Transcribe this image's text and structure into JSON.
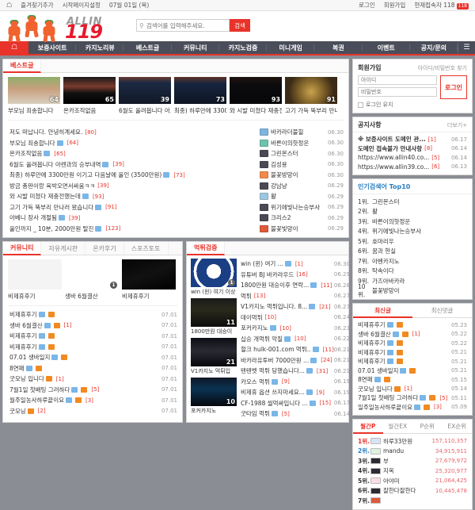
{
  "topbar": {
    "home_icon": "home-icon",
    "left_links": [
      "즐겨찾기추가",
      "시작페이지설정",
      "07월 01일 (목)"
    ],
    "right_links": [
      "로그인",
      "회원가입"
    ],
    "visitors_label": "현재접속자 118",
    "visitors_badge": "118"
  },
  "header": {
    "logo_top": "ALLIN",
    "logo_main": "119",
    "search_placeholder": "검색어를 입력해주세요.",
    "search_value": "",
    "search_button": "검색",
    "search_icon": "search-icon"
  },
  "nav": {
    "home_icon": "home-icon",
    "items": [
      "보증사이트",
      "카지노리뷰",
      "베스트글",
      "커뮤니티",
      "카지노검증",
      "미니게임",
      "복권",
      "이벤트",
      "공지/문의"
    ],
    "menu_icon": "hamburger-icon"
  },
  "best": {
    "tab": "베스트글",
    "thumbs": [
      {
        "title": "부모님 죄송합니다",
        "count": "64"
      },
      {
        "title": "온카조작없음",
        "count": "65"
      },
      {
        "title": "6월도 올려봅니다 아…",
        "count": "39"
      },
      {
        "title": "최종) 하루만에 3300…",
        "count": "73"
      },
      {
        "title": "와 시발 미쳤다 재충전",
        "count": "93"
      },
      {
        "title": "고기 가득 뚝부리 만나…",
        "count": "91"
      }
    ],
    "posts": [
      {
        "title": "저도 떠납니다. 안녕히계세요.",
        "count": "[80]",
        "img": false
      },
      {
        "title": "부모님 죄송합니다",
        "count": "[64]",
        "img": true
      },
      {
        "title": "온카조작없음",
        "count": "[65]",
        "img": true
      },
      {
        "title": "6월도 올려봅니다 아렌과의 승부내역",
        "count": "[39]",
        "img": true
      },
      {
        "title": "최종) 하루만에 3300만원 이기고 다음날에 올인 (3500만원)",
        "count": "[73]",
        "img": true
      },
      {
        "title": "방금 총판이랑 육박오면서싸움ㅋㅋ",
        "count": "[39]",
        "img": false
      },
      {
        "title": "와 시발 미쳤다 재충전했는데",
        "count": "[93]",
        "img": true
      },
      {
        "title": "고기 가득 뚝부리 만나러 왔습니다",
        "count": "[91]",
        "img": true
      },
      {
        "title": "아베니 장사 개절됨",
        "count": "[39]",
        "img": true
      },
      {
        "title": "올인까지 _ 10분, 2000만원 탈진",
        "count": "[123]",
        "img": true
      }
    ],
    "users": [
      {
        "name": "바카라더불힐",
        "time": "06.30",
        "color": "#7fb4dd"
      },
      {
        "name": "바른이의핫정운",
        "time": "06.30",
        "color": "#6fc3ad"
      },
      {
        "name": "그린몬스터",
        "time": "06.30",
        "color": "#4a4a55"
      },
      {
        "name": "김성용",
        "time": "06.30",
        "color": "#4a4a55"
      },
      {
        "name": "불꽃방망이",
        "time": "06.30",
        "color": "#f08a4a"
      },
      {
        "name": "강남냥",
        "time": "06.29",
        "color": "#4a4a55"
      },
      {
        "name": "활",
        "time": "06.29",
        "color": "#9ec6e0"
      },
      {
        "name": "위기에빛나는승부사",
        "time": "06.29",
        "color": "#4a4a55"
      },
      {
        "name": "크리스2",
        "time": "06.29",
        "color": "#4a4a55"
      },
      {
        "name": "불꽃빛망이",
        "time": "06.29",
        "color": "#e05a3a"
      }
    ]
  },
  "community": {
    "tabs": [
      "커뮤니티",
      "자유게시판",
      "온카후기",
      "스포츠토토"
    ],
    "thumbs": [
      {
        "title": "비제휴후기",
        "count": ""
      },
      {
        "title": "생바 6월결산",
        "count": "1"
      },
      {
        "title": "비제휴후기",
        "count": ""
      }
    ],
    "posts": [
      {
        "title": "비제휴후기",
        "count": "",
        "date": "07.01"
      },
      {
        "title": "생바 6월결산",
        "count": "[1]",
        "date": "07.01"
      },
      {
        "title": "비제휴후기",
        "count": "",
        "date": "07.01"
      },
      {
        "title": "비제휴후기",
        "count": "",
        "date": "07.01"
      },
      {
        "title": "07.01 생바일지",
        "count": "",
        "date": "07.01"
      },
      {
        "title": "8연패",
        "count": "",
        "date": "07.01"
      },
      {
        "title": "굿모닝 입니다",
        "count": "[1]",
        "date": "07.01"
      },
      {
        "title": "7월1일 첫배팅 그러하다",
        "count": "[5]",
        "date": "07.01"
      },
      {
        "title": "월주일농사하루끝이요",
        "count": "[3]",
        "date": "07.01"
      },
      {
        "title": "굿모닝",
        "count": "[2]",
        "date": "07.01"
      }
    ]
  },
  "verify": {
    "tab": "먹튀검증",
    "thumbs": [
      {
        "title": "win (윈) 여기 이상",
        "count": "1"
      },
      {
        "title": "1800만원 대승이",
        "count": "11"
      },
      {
        "title": "V1카지노 먹튀입",
        "count": "21"
      },
      {
        "title": "포커카지노",
        "count": "10"
      }
    ],
    "posts": [
      {
        "title": "win (윈) 여기 ...",
        "count": "[1]",
        "date": "06.30"
      },
      {
        "title": "유튜버 BJ 바카라우드",
        "count": "[16]",
        "date": "06.29"
      },
      {
        "title": "1800만원 대승이후 연락...",
        "count": "[11]",
        "date": "06.28"
      },
      {
        "title": "먹튀",
        "count": "[13]",
        "date": "06.27"
      },
      {
        "title": "V1카지노 먹튀입니다. 8...",
        "count": "[21]",
        "date": "06.27"
      },
      {
        "title": "데이먹튀",
        "count": "[10]",
        "date": "06.24"
      },
      {
        "title": "포커카지노",
        "count": "[10]",
        "date": "06.23"
      },
      {
        "title": "십승 개먹튀 악질",
        "count": "[10]",
        "date": "06.22"
      },
      {
        "title": "헐크 hulk-001.com 먹튀..",
        "count": "[11]",
        "date": "06.21"
      },
      {
        "title": "바카라유투버 7000만원 ...",
        "count": "[24]",
        "date": "06.21"
      },
      {
        "title": "텐텐벳 먹튀 당했습니다...",
        "count": "[31]",
        "date": "06.21"
      },
      {
        "title": "카오스 먹튀",
        "count": "[9]",
        "date": "06.19"
      },
      {
        "title": "비제휴 옵션 쓰지마세요...",
        "count": "[9]",
        "date": "06.19"
      },
      {
        "title": "CF-1988 씰먹싸입니다 ...",
        "count": "[15]",
        "date": "06.17"
      },
      {
        "title": "굿타임 먹튀",
        "count": "[5]",
        "date": "06.14"
      }
    ]
  },
  "login": {
    "title": "회원가입",
    "find_link": "아이디/비밀번호 찾기",
    "id_placeholder": "아이디",
    "id_value": "",
    "pw_placeholder": "비밀번호",
    "pw_value": "",
    "button": "로그인",
    "keep_label": "로그인 유지"
  },
  "notice": {
    "title": "공지사항",
    "more": "더보기+",
    "items": [
      {
        "title": "※ 보증사이트 도메인 관...",
        "count": "[1]",
        "date": "06.17",
        "bold": true
      },
      {
        "title": "도메인 접속불가 안내사항",
        "count": "[8]",
        "date": "06.14",
        "bold": true
      },
      {
        "title": "https://www.allin40.co...",
        "count": "[5]",
        "date": "06.14",
        "bold": false
      },
      {
        "title": "https://www.allin39.co...",
        "count": "[6]",
        "date": "06.13",
        "bold": false
      }
    ]
  },
  "keywords": {
    "title": "인기검색어 Top10",
    "items": [
      {
        "rank": "1위.",
        "word": "그린몬스터"
      },
      {
        "rank": "2위.",
        "word": "활"
      },
      {
        "rank": "3위.",
        "word": "바른이의핫정운"
      },
      {
        "rank": "4위.",
        "word": "위기에빛나는승부사"
      },
      {
        "rank": "5위.",
        "word": "호마리우"
      },
      {
        "rank": "6위.",
        "word": "꿈과 현실"
      },
      {
        "rank": "7위.",
        "word": "아벤카지노"
      },
      {
        "rank": "8위.",
        "word": "탁속이다"
      },
      {
        "rank": "9위.",
        "word": "가즈아바카라"
      },
      {
        "rank": "10위.",
        "word": "불꽃방망이"
      }
    ]
  },
  "latest": {
    "tabs": [
      "최신글",
      "최신댓글"
    ],
    "items": [
      {
        "title": "비제휴후기",
        "count": "",
        "time": "05.23"
      },
      {
        "title": "생바 6월결산",
        "count": "[1]",
        "time": "05.22"
      },
      {
        "title": "비제휴후기",
        "count": "",
        "time": "05.22"
      },
      {
        "title": "비제휴후기",
        "count": "",
        "time": "05.21"
      },
      {
        "title": "비제휴후기",
        "count": "",
        "time": "05.21"
      },
      {
        "title": "07.01 생바일지",
        "count": "",
        "time": "05.21"
      },
      {
        "title": "8연패",
        "count": "",
        "time": "05.15"
      },
      {
        "title": "굿모닝 입니다",
        "count": "[1]",
        "time": "05.14"
      },
      {
        "title": "7월1일 첫배팅 그러하다",
        "count": "[5]",
        "time": "05.11"
      },
      {
        "title": "일주일농사하루끝이요",
        "count": "[3]",
        "time": "05.09"
      }
    ]
  },
  "ranking": {
    "tabs": [
      "월간P",
      "월간EX",
      "P순위",
      "EX순위"
    ],
    "rows": [
      {
        "rank": "1위.",
        "name": "하루33만원",
        "value": "157,110,357",
        "color": "#d8e3f5"
      },
      {
        "rank": "2위.",
        "name": "mandu",
        "value": "34,915,911",
        "color": "#dff2e0"
      },
      {
        "rank": "3위.",
        "name": "부",
        "value": "27,679,972",
        "color": "#2b2b33"
      },
      {
        "rank": "4위.",
        "name": "지옥",
        "value": "25,320,977",
        "color": "#2b2b33"
      },
      {
        "rank": "5위.",
        "name": "아야미",
        "value": "21,064,425",
        "color": "#fbdde4"
      },
      {
        "rank": "6위.",
        "name": "잘한다잘한다",
        "value": "10,445,478",
        "color": "#2b2b33"
      },
      {
        "rank": "7위.",
        "name": "",
        "value": "",
        "color": "#e05a3a"
      }
    ]
  }
}
